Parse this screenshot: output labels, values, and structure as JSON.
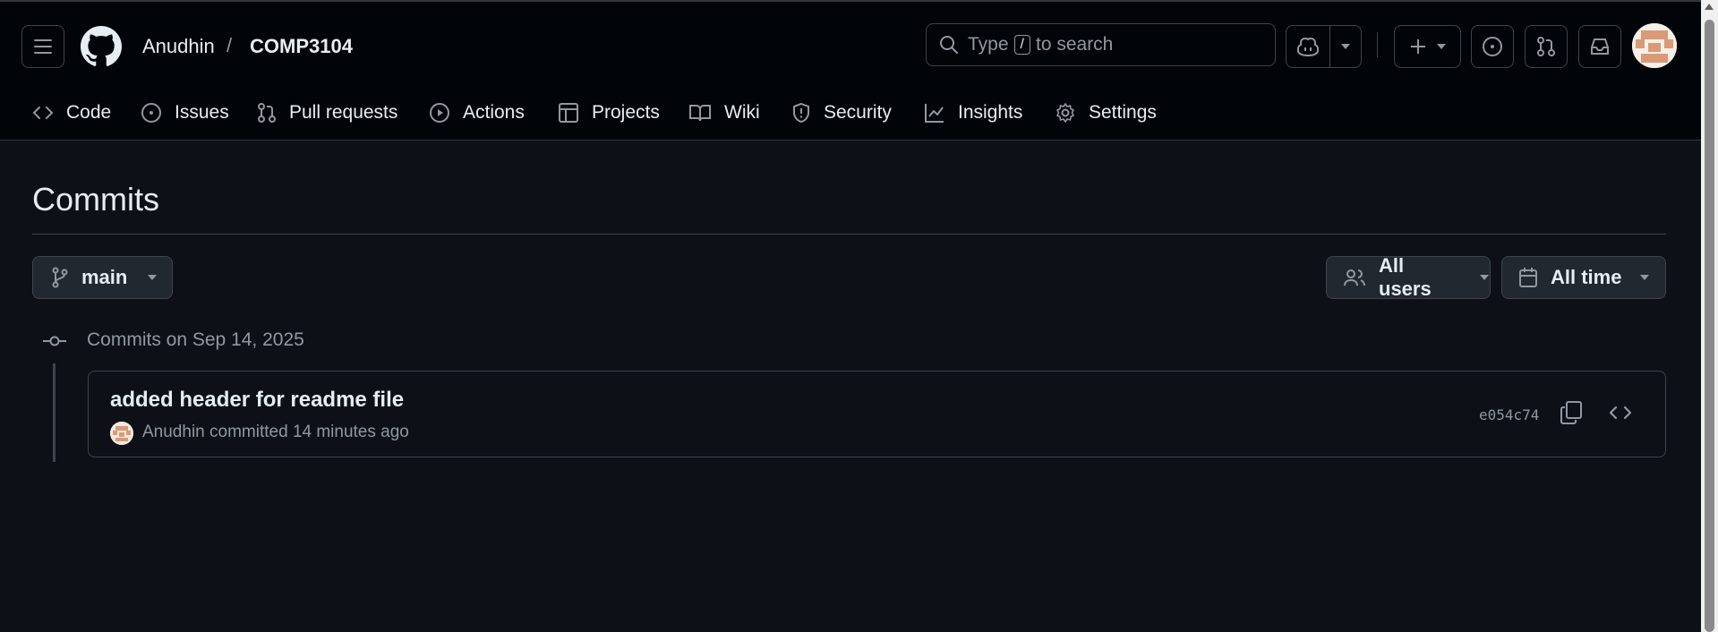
{
  "header": {
    "owner": "Anudhin",
    "separator": "/",
    "repo": "COMP3104",
    "search": {
      "prefix": "Type",
      "key": "/",
      "suffix": "to search"
    }
  },
  "nav": {
    "items": [
      {
        "label": "Code",
        "icon": "code-icon"
      },
      {
        "label": "Issues",
        "icon": "issue-icon"
      },
      {
        "label": "Pull requests",
        "icon": "pull-request-icon"
      },
      {
        "label": "Actions",
        "icon": "play-icon"
      },
      {
        "label": "Projects",
        "icon": "table-icon"
      },
      {
        "label": "Wiki",
        "icon": "book-icon"
      },
      {
        "label": "Security",
        "icon": "shield-icon"
      },
      {
        "label": "Insights",
        "icon": "graph-icon"
      },
      {
        "label": "Settings",
        "icon": "gear-icon"
      }
    ]
  },
  "page": {
    "title": "Commits",
    "branch": "main",
    "users_filter": "All users",
    "time_filter": "All time"
  },
  "commits": {
    "date_heading": "Commits on Sep 14, 2025",
    "items": [
      {
        "message": "added header for readme file",
        "author": "Anudhin",
        "action": "committed",
        "time": "14 minutes ago",
        "sha": "e054c74"
      }
    ]
  },
  "colors": {
    "background": "#0d1117",
    "header_bg": "#010409",
    "border": "#3d444d",
    "muted_text": "#9198a1",
    "text": "#e6edf3"
  }
}
